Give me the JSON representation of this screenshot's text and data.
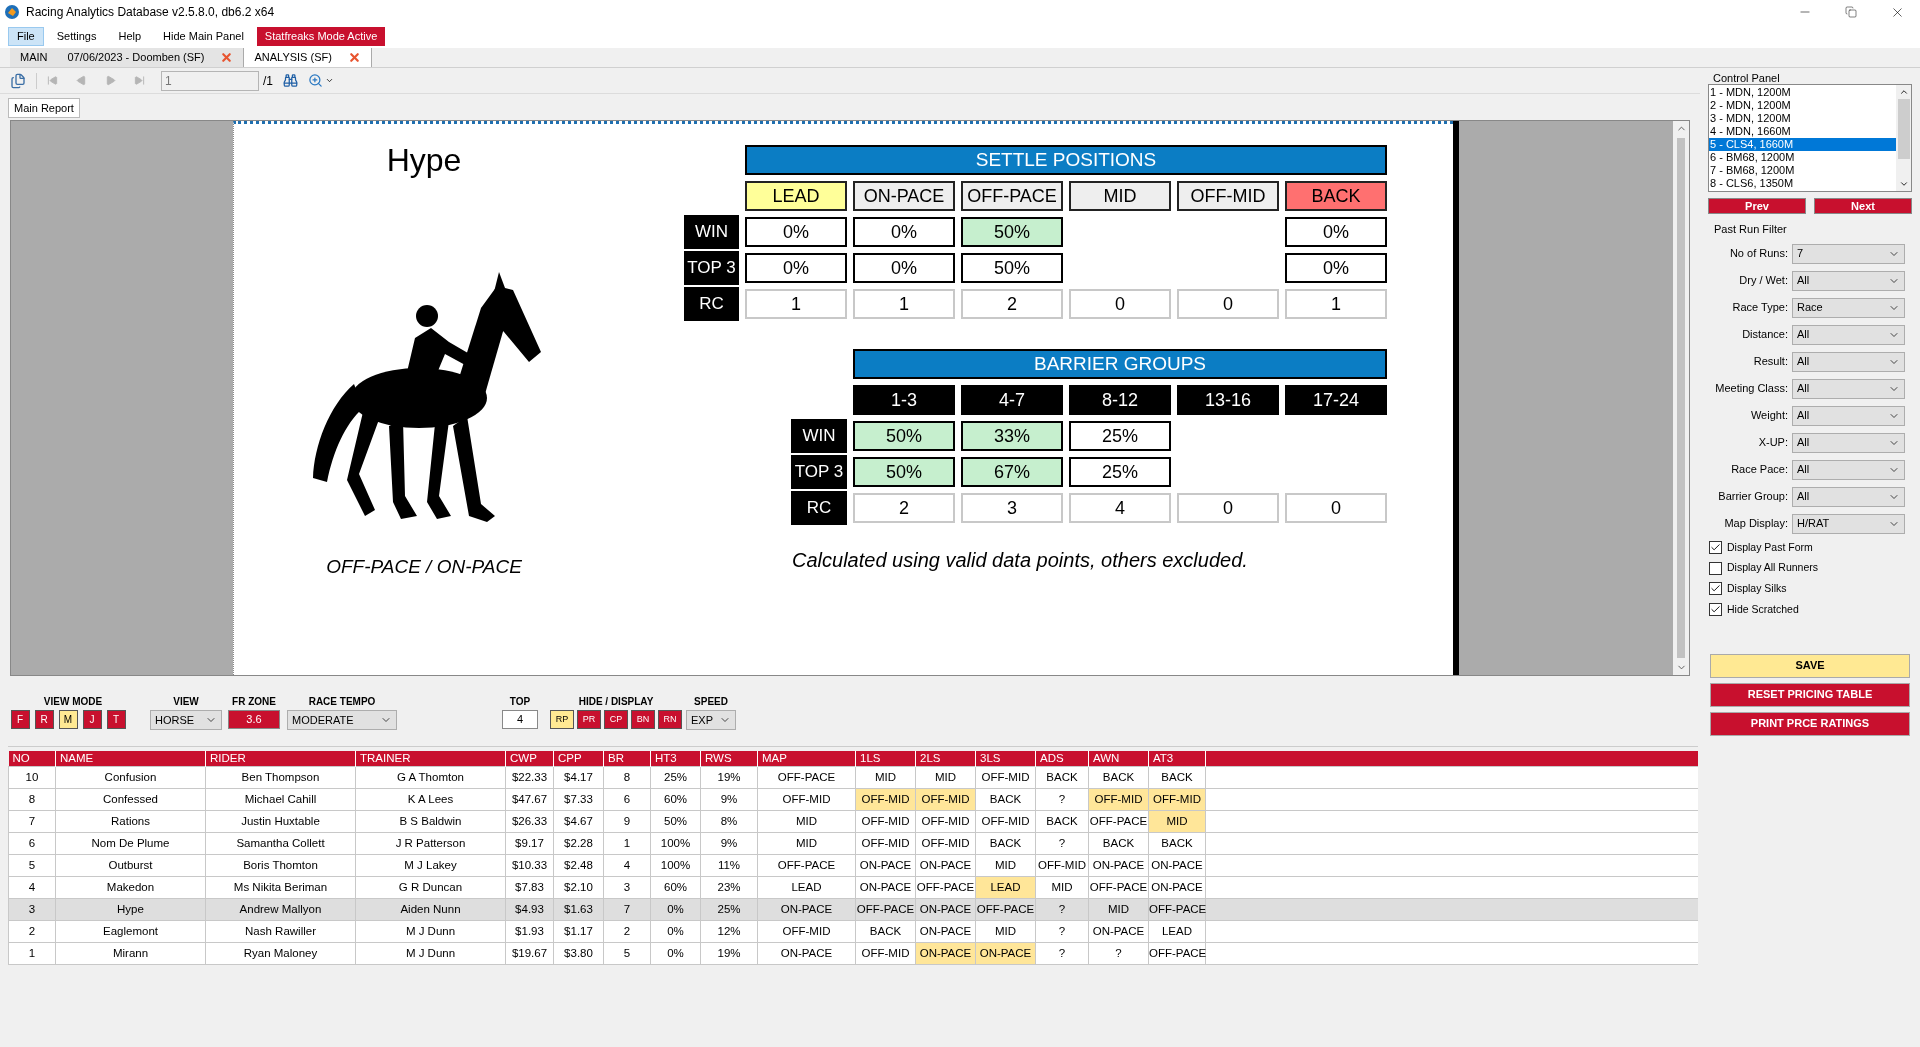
{
  "window": {
    "title": "Racing Analytics Database v2.5.8.0, db6.2 x64"
  },
  "menu": [
    {
      "label": "File",
      "selected": true,
      "kind": "item"
    },
    {
      "label": "Settings",
      "selected": false,
      "kind": "item"
    },
    {
      "label": "Help",
      "selected": false,
      "kind": "item"
    },
    {
      "label": "Hide Main Panel",
      "selected": false,
      "kind": "item"
    },
    {
      "label": "Statfreaks Mode Active",
      "kind": "status"
    }
  ],
  "tabs": [
    {
      "label": "MAIN",
      "selected": false,
      "closable": false
    },
    {
      "label": "07/06/2023 - Doomben (SF)",
      "selected": false,
      "closable": true
    },
    {
      "label": "ANALYSIS (SF)",
      "selected": true,
      "closable": true
    }
  ],
  "toolbar": {
    "page": "1",
    "page_count": "/1"
  },
  "report_tabs": [
    {
      "label": "Main Report",
      "selected": true
    }
  ],
  "report": {
    "horse_name": "Hype",
    "pace_label": "OFF-PACE / ON-PACE",
    "note": "Calculated using valid data points, others excluded.",
    "settle_positions": {
      "title": "SETTLE POSITIONS",
      "row_labels": [
        "WIN",
        "TOP 3",
        "RC"
      ],
      "columns": [
        {
          "label": "LEAD",
          "color": "#ffff99",
          "win": {
            "text": "0%",
            "highlight": false
          },
          "top3": {
            "text": "0%",
            "highlight": false
          },
          "rc": "1"
        },
        {
          "label": "ON-PACE",
          "color": "#eeeeee",
          "win": {
            "text": "0%",
            "highlight": false
          },
          "top3": {
            "text": "0%",
            "highlight": false
          },
          "rc": "1"
        },
        {
          "label": "OFF-PACE",
          "color": "#eeeeee",
          "win": {
            "text": "50%",
            "highlight": true
          },
          "top3": {
            "text": "50%",
            "highlight": false
          },
          "rc": "2"
        },
        {
          "label": "MID",
          "color": "#eeeeee",
          "rc": "0"
        },
        {
          "label": "OFF-MID",
          "color": "#eeeeee",
          "rc": "0"
        },
        {
          "label": "BACK",
          "color": "#ff7070",
          "win": {
            "text": "0%",
            "highlight": false
          },
          "top3": {
            "text": "0%",
            "highlight": false
          },
          "rc": "1"
        }
      ]
    },
    "barrier_groups": {
      "title": "BARRIER GROUPS",
      "row_labels": [
        "WIN",
        "TOP 3",
        "RC"
      ],
      "columns": [
        {
          "label": "1-3",
          "win": {
            "text": "50%",
            "highlight": true
          },
          "top3": {
            "text": "50%",
            "highlight": true
          },
          "rc": "2"
        },
        {
          "label": "4-7",
          "win": {
            "text": "33%",
            "highlight": true
          },
          "top3": {
            "text": "67%",
            "highlight": true
          },
          "rc": "3"
        },
        {
          "label": "8-12",
          "win": {
            "text": "25%",
            "highlight": false
          },
          "top3": {
            "text": "25%",
            "highlight": false
          },
          "rc": "4"
        },
        {
          "label": "13-16",
          "rc": "0"
        },
        {
          "label": "17-24",
          "rc": "0"
        }
      ]
    }
  },
  "controls": {
    "view_mode": {
      "label": "VIEW MODE",
      "buttons": [
        {
          "label": "F",
          "selected": false
        },
        {
          "label": "R",
          "selected": false
        },
        {
          "label": "M",
          "selected": true
        },
        {
          "label": "J",
          "selected": false
        },
        {
          "label": "T",
          "selected": false
        }
      ]
    },
    "view": {
      "label": "VIEW",
      "value": "HORSE"
    },
    "fr_zone": {
      "label": "FR ZONE",
      "value": "3.6"
    },
    "race_tempo": {
      "label": "RACE TEMPO",
      "value": "MODERATE"
    },
    "top": {
      "label": "TOP",
      "value": "4"
    },
    "hide_display": {
      "label": "HIDE / DISPLAY",
      "buttons": [
        {
          "label": "RP",
          "on": false
        },
        {
          "label": "PR",
          "on": true
        },
        {
          "label": "CP",
          "on": true
        },
        {
          "label": "BN",
          "on": true
        },
        {
          "label": "RN",
          "on": true
        }
      ]
    },
    "speed": {
      "label": "SPEED",
      "value": "EXP"
    }
  },
  "table": {
    "columns": [
      "NO",
      "NAME",
      "RIDER",
      "TRAINER",
      "CWP",
      "CPP",
      "BR",
      "HT3",
      "RWS",
      "MAP",
      "1LS",
      "2LS",
      "3LS",
      "ADS",
      "AWN",
      "AT3"
    ],
    "rows": [
      {
        "selected": false,
        "cells": [
          "10",
          "Confusion",
          "Ben Thompson",
          "G A Thomton",
          "$22.33",
          "$4.17",
          "8",
          "25%",
          "19%",
          "OFF-PACE"
        ],
        "runs": [
          {
            "text": "MID",
            "highlight": false
          },
          {
            "text": "MID",
            "highlight": false
          },
          {
            "text": "OFF-MID",
            "highlight": false
          },
          {
            "text": "BACK",
            "highlight": false
          },
          {
            "text": "BACK",
            "highlight": false
          },
          {
            "text": "BACK",
            "highlight": false
          }
        ]
      },
      {
        "selected": false,
        "cells": [
          "8",
          "Confessed",
          "Michael Cahill",
          "K A Lees",
          "$47.67",
          "$7.33",
          "6",
          "60%",
          "9%",
          "OFF-MID"
        ],
        "runs": [
          {
            "text": "OFF-MID",
            "highlight": true
          },
          {
            "text": "OFF-MID",
            "highlight": true
          },
          {
            "text": "BACK",
            "highlight": false
          },
          {
            "text": "?",
            "highlight": false
          },
          {
            "text": "OFF-MID",
            "highlight": true
          },
          {
            "text": "OFF-MID",
            "highlight": true
          }
        ]
      },
      {
        "selected": false,
        "cells": [
          "7",
          "Rations",
          "Justin Huxtable",
          "B S Baldwin",
          "$26.33",
          "$4.67",
          "9",
          "50%",
          "8%",
          "MID"
        ],
        "runs": [
          {
            "text": "OFF-MID",
            "highlight": false
          },
          {
            "text": "OFF-MID",
            "highlight": false
          },
          {
            "text": "OFF-MID",
            "highlight": false
          },
          {
            "text": "BACK",
            "highlight": false
          },
          {
            "text": "OFF-PACE",
            "highlight": false
          },
          {
            "text": "MID",
            "highlight": true
          }
        ]
      },
      {
        "selected": false,
        "cells": [
          "6",
          "Nom De Plume",
          "Samantha Collett",
          "J R Patterson",
          "$9.17",
          "$2.28",
          "1",
          "100%",
          "9%",
          "MID"
        ],
        "runs": [
          {
            "text": "OFF-MID",
            "highlight": false
          },
          {
            "text": "OFF-MID",
            "highlight": false
          },
          {
            "text": "BACK",
            "highlight": false
          },
          {
            "text": "?",
            "highlight": false
          },
          {
            "text": "BACK",
            "highlight": false
          },
          {
            "text": "BACK",
            "highlight": false
          }
        ]
      },
      {
        "selected": false,
        "cells": [
          "5",
          "Outburst",
          "Boris Thomton",
          "M J Lakey",
          "$10.33",
          "$2.48",
          "4",
          "100%",
          "11%",
          "OFF-PACE"
        ],
        "runs": [
          {
            "text": "ON-PACE",
            "highlight": false
          },
          {
            "text": "ON-PACE",
            "highlight": false
          },
          {
            "text": "MID",
            "highlight": false
          },
          {
            "text": "OFF-MID",
            "highlight": false
          },
          {
            "text": "ON-PACE",
            "highlight": false
          },
          {
            "text": "ON-PACE",
            "highlight": false
          }
        ]
      },
      {
        "selected": false,
        "cells": [
          "4",
          "Makedon",
          "Ms Nikita Beriman",
          "G R Duncan",
          "$7.83",
          "$2.10",
          "3",
          "60%",
          "23%",
          "LEAD"
        ],
        "runs": [
          {
            "text": "ON-PACE",
            "highlight": false
          },
          {
            "text": "OFF-PACE",
            "highlight": false
          },
          {
            "text": "LEAD",
            "highlight": true
          },
          {
            "text": "MID",
            "highlight": false
          },
          {
            "text": "OFF-PACE",
            "highlight": false
          },
          {
            "text": "ON-PACE",
            "highlight": false
          }
        ]
      },
      {
        "selected": true,
        "cells": [
          "3",
          "Hype",
          "Andrew Mallyon",
          "Aiden Nunn",
          "$4.93",
          "$1.63",
          "7",
          "0%",
          "25%",
          "ON-PACE"
        ],
        "runs": [
          {
            "text": "OFF-PACE",
            "highlight": false
          },
          {
            "text": "ON-PACE",
            "highlight": false
          },
          {
            "text": "OFF-PACE",
            "highlight": false
          },
          {
            "text": "?",
            "highlight": false
          },
          {
            "text": "MID",
            "highlight": false
          },
          {
            "text": "OFF-PACE",
            "highlight": false
          }
        ]
      },
      {
        "selected": false,
        "cells": [
          "2",
          "Eaglemont",
          "Nash Rawiller",
          "M J Dunn",
          "$1.93",
          "$1.17",
          "2",
          "0%",
          "12%",
          "OFF-MID"
        ],
        "runs": [
          {
            "text": "BACK",
            "highlight": false
          },
          {
            "text": "ON-PACE",
            "highlight": false
          },
          {
            "text": "MID",
            "highlight": false
          },
          {
            "text": "?",
            "highlight": false
          },
          {
            "text": "ON-PACE",
            "highlight": false
          },
          {
            "text": "LEAD",
            "highlight": false
          }
        ]
      },
      {
        "selected": false,
        "cells": [
          "1",
          "Mirann",
          "Ryan Maloney",
          "M J Dunn",
          "$19.67",
          "$3.80",
          "5",
          "0%",
          "19%",
          "ON-PACE"
        ],
        "runs": [
          {
            "text": "OFF-MID",
            "highlight": false
          },
          {
            "text": "ON-PACE",
            "highlight": true
          },
          {
            "text": "ON-PACE",
            "highlight": true
          },
          {
            "text": "?",
            "highlight": false
          },
          {
            "text": "?",
            "highlight": false
          },
          {
            "text": "OFF-PACE",
            "highlight": false
          }
        ]
      }
    ]
  },
  "control_panel": {
    "title": "Control Panel",
    "races": [
      {
        "label": "1 - MDN, 1200M",
        "selected": false
      },
      {
        "label": "2 - MDN, 1200M",
        "selected": false
      },
      {
        "label": "3 - MDN, 1200M",
        "selected": false
      },
      {
        "label": "4 - MDN, 1660M",
        "selected": false
      },
      {
        "label": "5 - CLS4, 1660M",
        "selected": true
      },
      {
        "label": "6 - BM68, 1200M",
        "selected": false
      },
      {
        "label": "7 - BM68, 1200M",
        "selected": false
      },
      {
        "label": "8 - CLS6, 1350M",
        "selected": false
      }
    ],
    "nav_buttons": [
      "Prev",
      "Next"
    ],
    "filter_title": "Past Run Filter",
    "filters": [
      {
        "label": "No of Runs:",
        "value": "7"
      },
      {
        "label": "Dry / Wet:",
        "value": "All"
      },
      {
        "label": "Race Type:",
        "value": "Race"
      },
      {
        "label": "Distance:",
        "value": "All"
      },
      {
        "label": "Result:",
        "value": "All"
      },
      {
        "label": "Meeting Class:",
        "value": "All"
      },
      {
        "label": "Weight:",
        "value": "All"
      },
      {
        "label": "X-UP:",
        "value": "All"
      },
      {
        "label": "Race Pace:",
        "value": "All"
      },
      {
        "label": "Barrier Group:",
        "value": "All"
      },
      {
        "label": "Map Display:",
        "value": "H/RAT"
      }
    ],
    "checkboxes": [
      {
        "label": "Display Past Form",
        "checked": true
      },
      {
        "label": "Display All Runners",
        "checked": false
      },
      {
        "label": "Display Silks",
        "checked": true
      },
      {
        "label": "Hide Scratched",
        "checked": true
      }
    ],
    "buttons": [
      {
        "label": "SAVE",
        "kind": "primary"
      },
      {
        "label": "RESET PRICING TABLE",
        "kind": "danger"
      },
      {
        "label": "PRINT PRCE RATINGS",
        "kind": "danger"
      }
    ]
  }
}
